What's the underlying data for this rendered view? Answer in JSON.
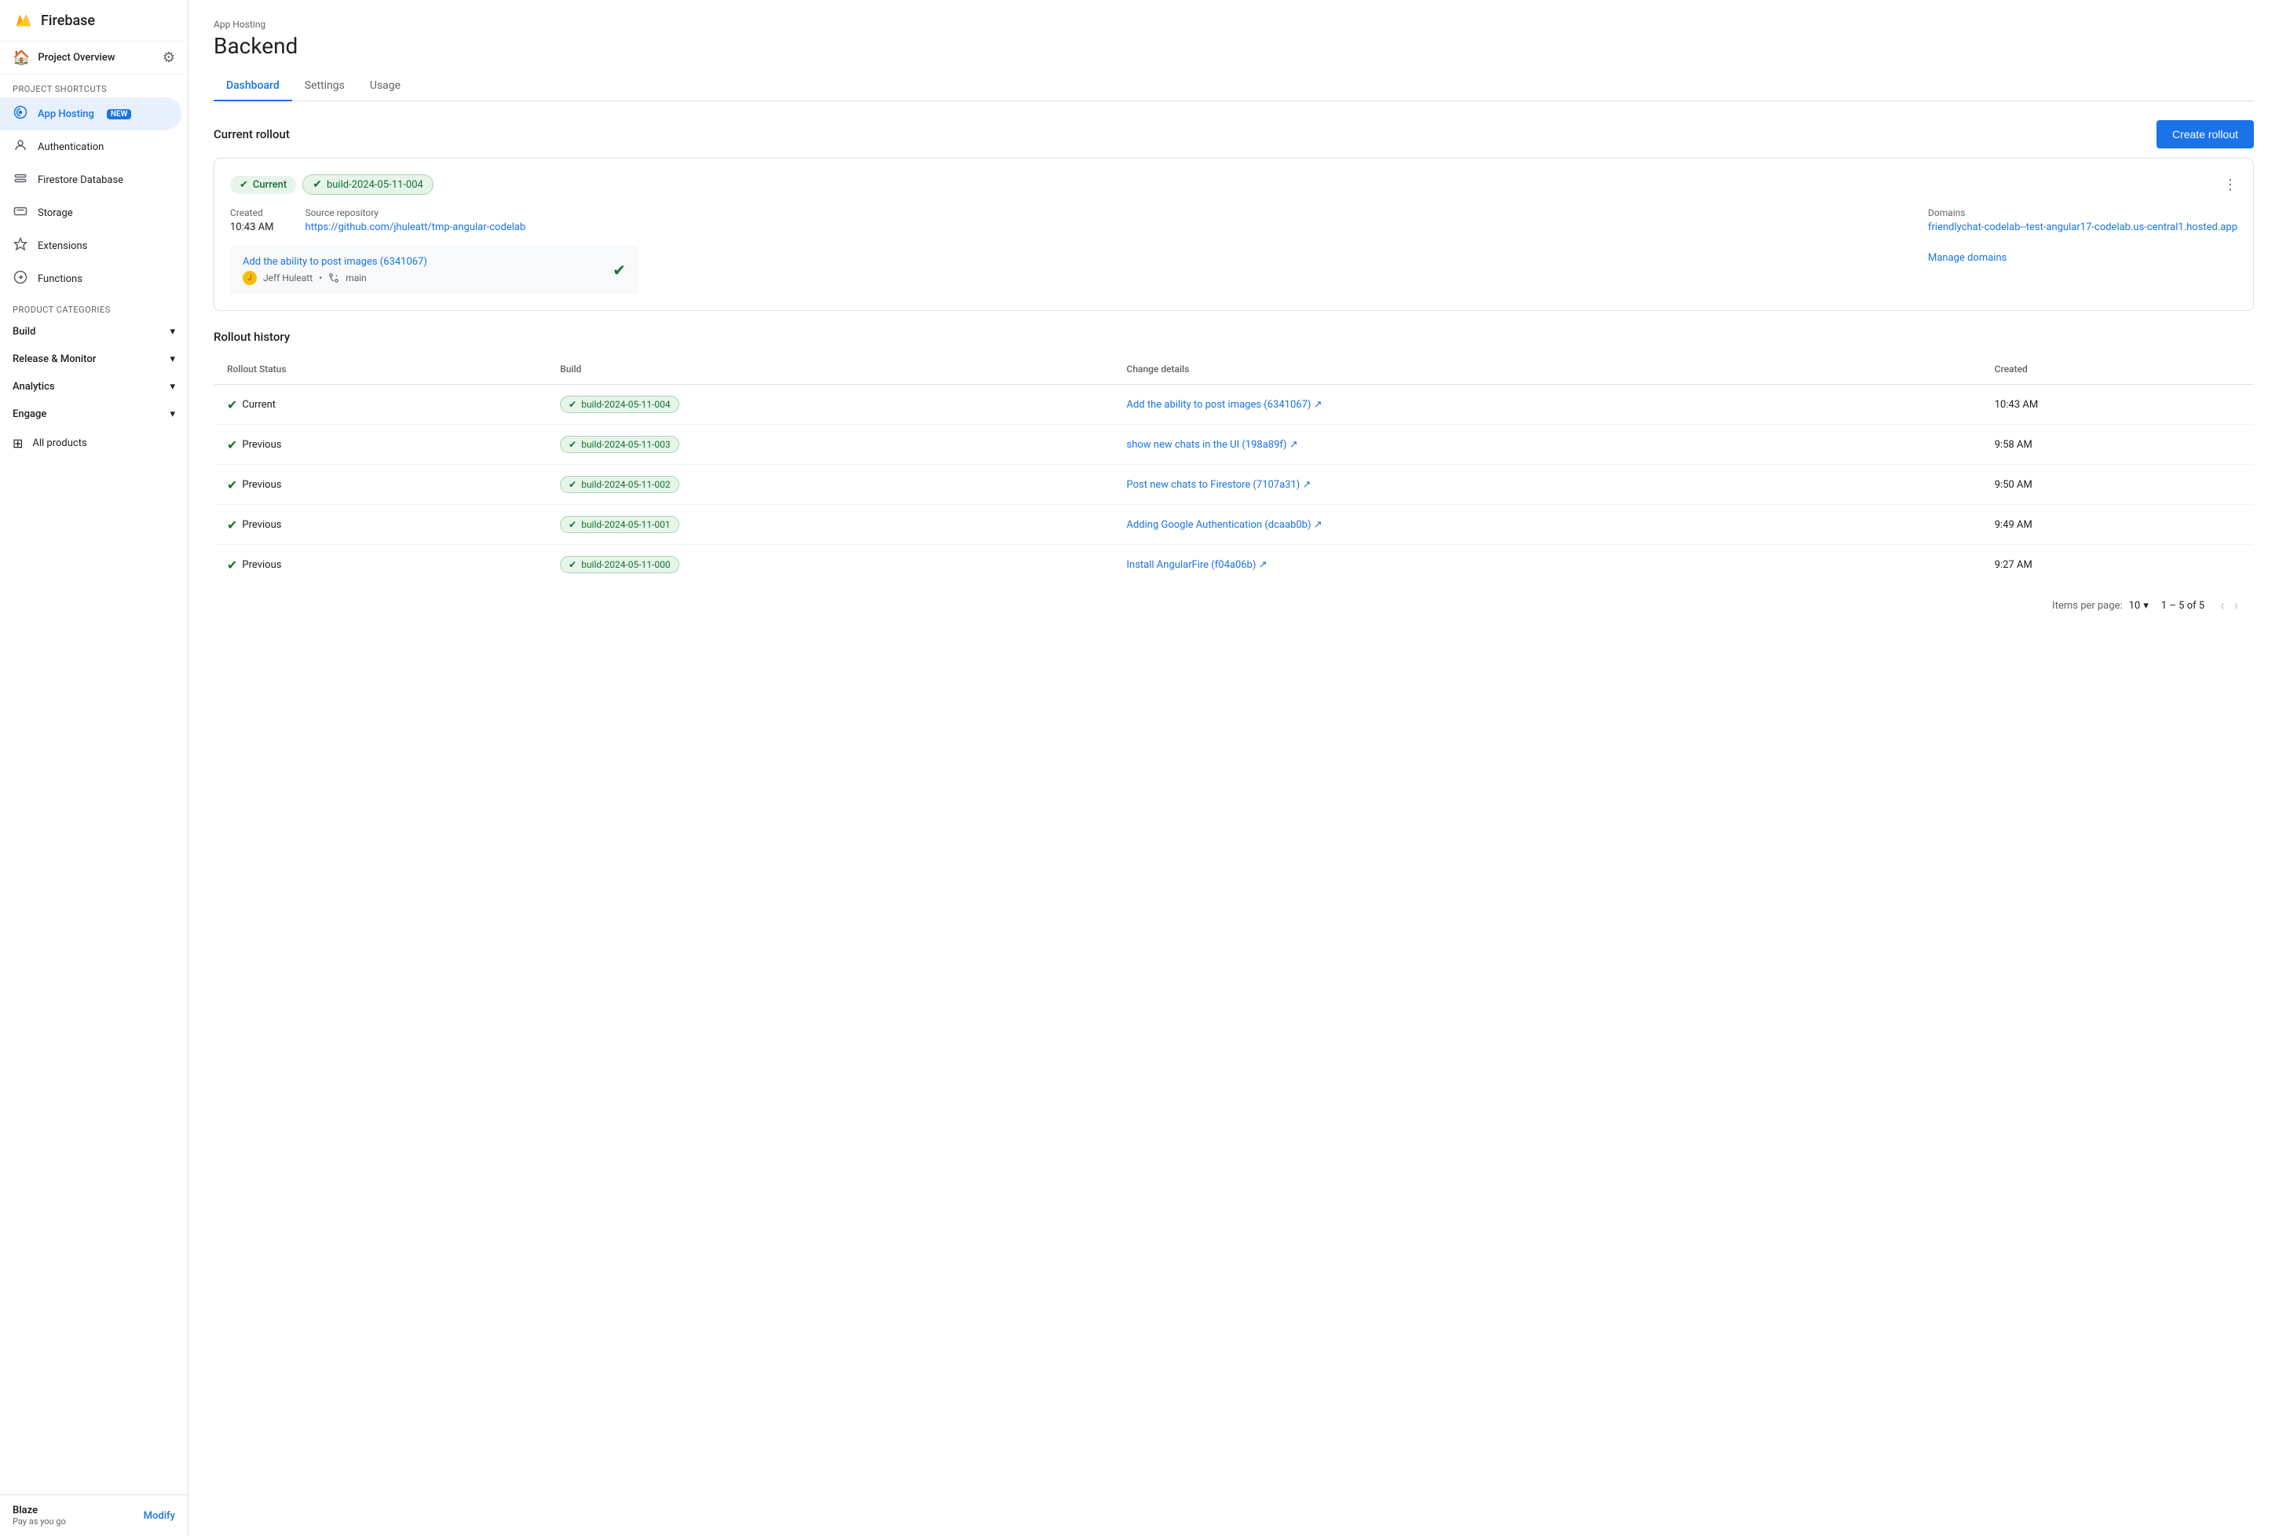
{
  "app": {
    "name": "Firebase"
  },
  "sidebar": {
    "project_overview": "Project Overview",
    "project_shortcuts_label": "Project shortcuts",
    "product_categories_label": "Product categories",
    "items": [
      {
        "id": "app-hosting",
        "label": "App Hosting",
        "badge": "NEW",
        "active": true
      },
      {
        "id": "authentication",
        "label": "Authentication"
      },
      {
        "id": "firestore",
        "label": "Firestore Database"
      },
      {
        "id": "storage",
        "label": "Storage"
      },
      {
        "id": "extensions",
        "label": "Extensions"
      },
      {
        "id": "functions",
        "label": "Functions"
      }
    ],
    "categories": [
      {
        "id": "build",
        "label": "Build"
      },
      {
        "id": "release-monitor",
        "label": "Release & Monitor"
      },
      {
        "id": "analytics",
        "label": "Analytics"
      },
      {
        "id": "engage",
        "label": "Engage"
      }
    ],
    "all_products": "All products",
    "footer": {
      "plan": "Blaze",
      "sub": "Pay as you go",
      "modify": "Modify"
    }
  },
  "page": {
    "superlabel": "App Hosting",
    "title": "Backend",
    "tabs": [
      {
        "id": "dashboard",
        "label": "Dashboard",
        "active": true
      },
      {
        "id": "settings",
        "label": "Settings"
      },
      {
        "id": "usage",
        "label": "Usage"
      }
    ]
  },
  "current_rollout": {
    "section_title": "Current rollout",
    "create_btn": "Create rollout",
    "badge_current": "Current",
    "badge_build": "build-2024-05-11-004",
    "created_label": "Created",
    "created_value": "10:43 AM",
    "source_repo_label": "Source repository",
    "source_repo_text": "https://github.com/jhuleatt/tmp-angular-codelab",
    "source_repo_url": "#",
    "domains_label": "Domains",
    "domain_text": "friendlychat-codelab--test-angular17-codelab.us-central1.hosted.app",
    "domain_url": "#",
    "manage_domains": "Manage domains",
    "commit_title": "Add the ability to post images (6341067)",
    "commit_url": "#",
    "commit_author": "Jeff Huleatt",
    "commit_branch": "main"
  },
  "rollout_history": {
    "section_title": "Rollout history",
    "columns": [
      "Rollout Status",
      "Build",
      "Change details",
      "Created"
    ],
    "rows": [
      {
        "status": "Current",
        "build": "build-2024-05-11-004",
        "change": "Add the ability to post images (6341067)",
        "change_url": "#",
        "created": "10:43 AM"
      },
      {
        "status": "Previous",
        "build": "build-2024-05-11-003",
        "change": "show new chats in the UI (198a89f)",
        "change_url": "#",
        "created": "9:58 AM"
      },
      {
        "status": "Previous",
        "build": "build-2024-05-11-002",
        "change": "Post new chats to Firestore (7107a31)",
        "change_url": "#",
        "created": "9:50 AM"
      },
      {
        "status": "Previous",
        "build": "build-2024-05-11-001",
        "change": "Adding Google Authentication (dcaab0b)",
        "change_url": "#",
        "created": "9:49 AM"
      },
      {
        "status": "Previous",
        "build": "build-2024-05-11-000",
        "change": "Install AngularFire (f04a06b)",
        "change_url": "#",
        "created": "9:27 AM"
      }
    ],
    "pagination": {
      "items_per_page_label": "Items per page:",
      "per_page": "10",
      "range": "1 – 5 of 5"
    }
  }
}
